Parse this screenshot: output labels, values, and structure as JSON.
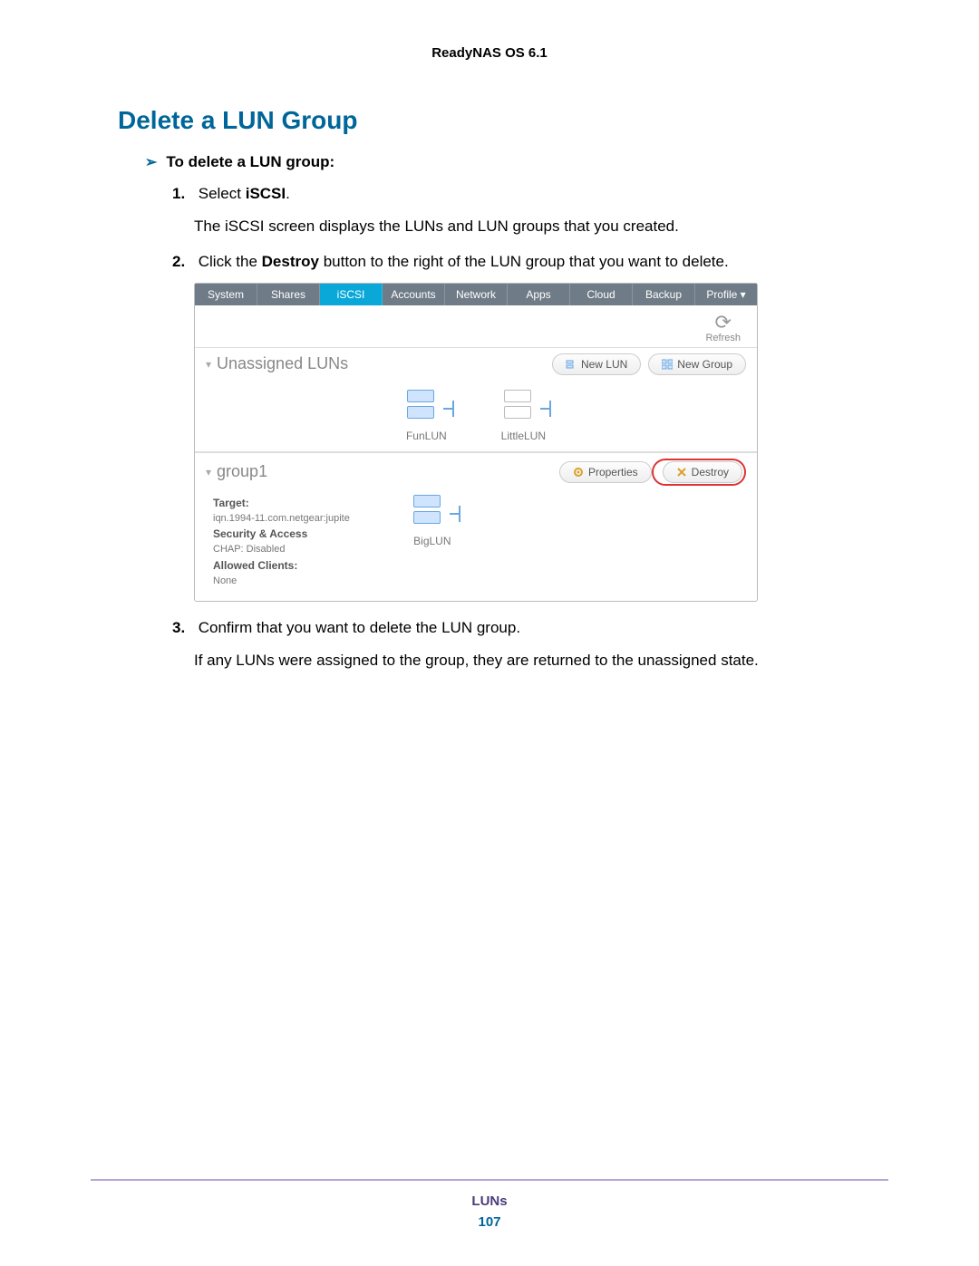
{
  "doc_header": "ReadyNAS OS 6.1",
  "section_title": "Delete a LUN Group",
  "proc_title": "To delete a LUN group:",
  "steps": {
    "s1_num": "1.",
    "s1_a": "Select ",
    "s1_b": "iSCSI",
    "s1_c": ".",
    "s1_cont": "The iSCSI screen displays the LUNs and LUN groups that you created.",
    "s2_num": "2.",
    "s2_a": "Click the ",
    "s2_b": "Destroy",
    "s2_c": " button to the right of the LUN group that you want to delete.",
    "s3_num": "3.",
    "s3_text": "Confirm that you want to delete the LUN group.",
    "s3_cont": "If any LUNs were assigned to the group, they are returned to the unassigned state."
  },
  "screenshot": {
    "nav": {
      "system": "System",
      "shares": "Shares",
      "iscsi": "iSCSI",
      "accounts": "Accounts",
      "network": "Network",
      "apps": "Apps",
      "cloud": "Cloud",
      "backup": "Backup",
      "profile": "Profile ▾"
    },
    "refresh": "Refresh",
    "unassigned_label": "Unassigned LUNs",
    "btn_new_lun": "New LUN",
    "btn_new_group": "New Group",
    "lun1": "FunLUN",
    "lun2": "LittleLUN",
    "group_label": "group1",
    "btn_properties": "Properties",
    "btn_destroy": "Destroy",
    "meta": {
      "target_lbl": "Target:",
      "target_val": "iqn.1994-11.com.netgear:jupite",
      "sec_lbl": "Security & Access",
      "sec_val": "CHAP: Disabled",
      "clients_lbl": "Allowed Clients:",
      "clients_val": "None"
    },
    "group_lun": "BigLUN"
  },
  "footer_label": "LUNs",
  "footer_page": "107"
}
